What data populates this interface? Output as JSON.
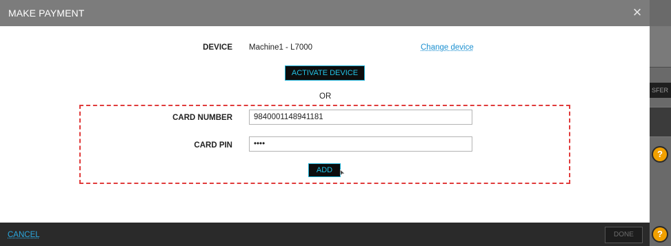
{
  "modal": {
    "title": "MAKE PAYMENT",
    "close_glyph": "×"
  },
  "device": {
    "label": "DEVICE",
    "value": "Machine1 - L7000",
    "change_link": "Change device",
    "activate_button": "ACTIVATE DEVICE"
  },
  "separator": "OR",
  "card": {
    "number_label": "CARD NUMBER",
    "number_value": "9840001148941181",
    "pin_label": "CARD PIN",
    "pin_value": "••••",
    "add_button": "ADD"
  },
  "footer": {
    "cancel_label": "CANCEL",
    "done_label": "DONE"
  },
  "background": {
    "partial_button_text": "SFER",
    "help_glyph": "?"
  },
  "colors": {
    "accent": "#23c3e6",
    "link": "#1a8fd0",
    "highlight_border": "#e03a3a",
    "header_bg": "#7c7c7c",
    "footer_bg": "#2a2a2a",
    "help_icon": "#f0a000"
  }
}
